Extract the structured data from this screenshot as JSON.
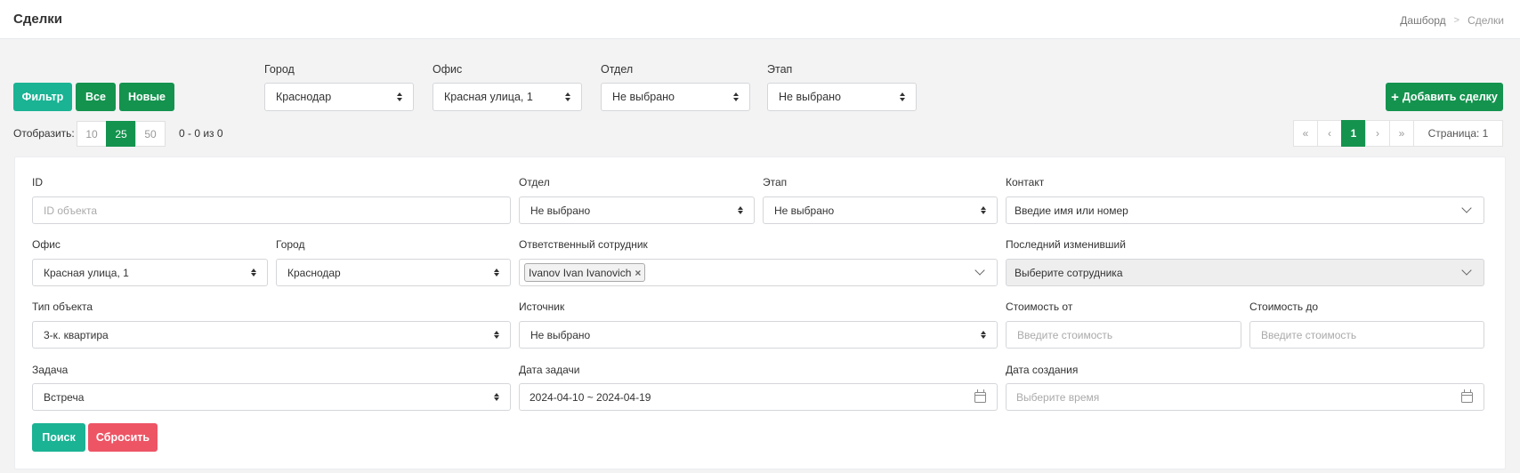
{
  "header": {
    "title": "Сделки",
    "breadcrumb": [
      "Дашборд",
      "Сделки"
    ]
  },
  "toolbar": {
    "filter_label": "Фильтр",
    "all_label": "Все",
    "new_label": "Новые",
    "add_deal_label": "Добавить сделку"
  },
  "top_filters": {
    "city": {
      "label": "Город",
      "value": "Краснодар"
    },
    "office": {
      "label": "Офис",
      "value": "Красная улица, 1"
    },
    "department": {
      "label": "Отдел",
      "value": "Не выбрано"
    },
    "stage": {
      "label": "Этап",
      "value": "Не выбрано"
    }
  },
  "list_controls": {
    "per_page_label": "Отобразить:",
    "per_page_options": [
      "10",
      "25",
      "50"
    ],
    "per_page_selected": "25",
    "count_text": "0 - 0 из 0"
  },
  "pagination": {
    "first": "«",
    "prev": "‹",
    "current": "1",
    "next": "›",
    "last": "»",
    "page_text": "Страница: 1"
  },
  "form": {
    "id": {
      "label": "ID",
      "placeholder": "ID объекта"
    },
    "department": {
      "label": "Отдел",
      "value": "Не выбрано"
    },
    "stage": {
      "label": "Этап",
      "value": "Не выбрано"
    },
    "contact": {
      "label": "Контакт",
      "value": "Введие имя или номер"
    },
    "office": {
      "label": "Офис",
      "value": "Красная улица, 1"
    },
    "city": {
      "label": "Город",
      "value": "Краснодар"
    },
    "responsible": {
      "label": "Ответственный сотрудник",
      "tag": "Ivanov Ivan Ivanovich",
      "remove": "×"
    },
    "last_modified": {
      "label": "Последний изменивший",
      "value": "Выберите сотрудника"
    },
    "object_type": {
      "label": "Тип объекта",
      "value": "3-к. квартира"
    },
    "source": {
      "label": "Источник",
      "value": "Не выбрано"
    },
    "price_from": {
      "label": "Стоимость от",
      "placeholder": "Введите стоимость"
    },
    "price_to": {
      "label": "Стоимость до",
      "placeholder": "Введите стоимость"
    },
    "task": {
      "label": "Задача",
      "value": "Встреча"
    },
    "task_date": {
      "label": "Дата задачи",
      "value": "2024-04-10 ~ 2024-04-19"
    },
    "created_date": {
      "label": "Дата создания",
      "placeholder": "Выберите время"
    },
    "search_label": "Поиск",
    "reset_label": "Сбросить"
  },
  "colors": {
    "teal": "#1ab394",
    "green": "#14934e",
    "red": "#ed5565",
    "background": "#f3f3f4"
  }
}
